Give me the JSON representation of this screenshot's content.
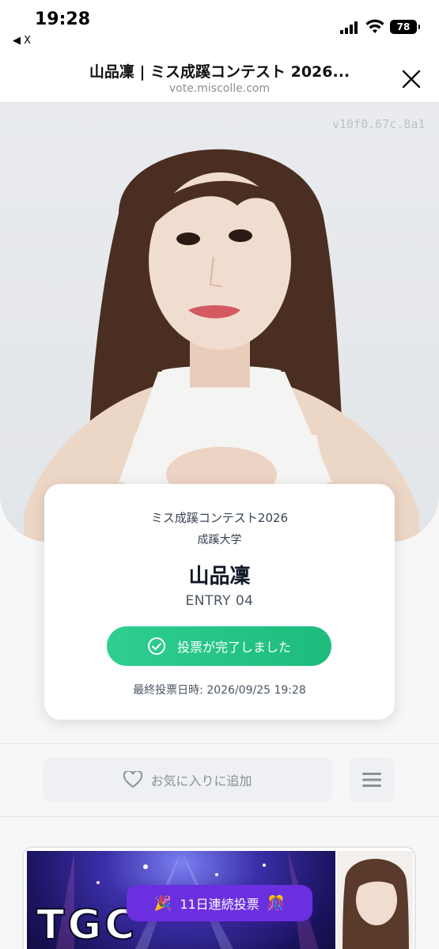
{
  "status_bar": {
    "time": "19:28",
    "back_label": "◀ X",
    "battery": "78"
  },
  "header": {
    "title": "山品凜 | ミス成蹊コンテスト 2026...",
    "domain": "vote.miscolle.com"
  },
  "photo": {
    "watermark": "v10f0.67c.8a1"
  },
  "card": {
    "contest": "ミス成蹊コンテスト2026",
    "university": "成蹊大学",
    "name": "山品凜",
    "entry": "ENTRY 04",
    "vote_button_label": "投票が完了しました",
    "last_vote": "最終投票日時: 2026/09/25 19:28"
  },
  "actions": {
    "favorite_label": "お気に入りに追加"
  },
  "banner": {
    "logo_text": "TGC",
    "streak_label": "11日連続投票",
    "colors": {
      "streak_bg": "#6b2fe0",
      "vote_green": "#1dbb7c"
    }
  }
}
